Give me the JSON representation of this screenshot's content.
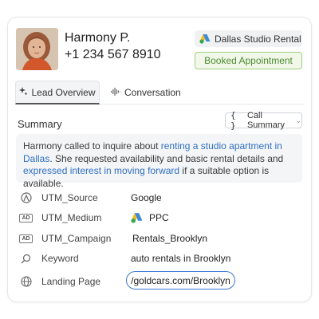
{
  "contact": {
    "name": "Harmony P.",
    "phone": "+1 234 567 8910"
  },
  "source": {
    "label": "Dallas Studio Rental",
    "icon": "google-ads-icon"
  },
  "status": {
    "label": "Booked Appointment",
    "color": "#9fcf7d"
  },
  "tabs": [
    {
      "label": "Lead Overview",
      "icon": "sparkle-icon",
      "active": true
    },
    {
      "label": "Conversation",
      "icon": "waveform-icon",
      "active": false
    }
  ],
  "summary": {
    "title": "Summary",
    "button_label": "Call Summary",
    "text_parts": [
      "Harmony called to inquire about ",
      "renting a studio apartment in Dallas",
      ". She requested availability and basic rental details and ",
      "expressed interest in moving forward",
      " if a suitable option is available."
    ]
  },
  "details": [
    {
      "label": "UTM_Source",
      "value": "Google",
      "icon": "source-icon"
    },
    {
      "label": "UTM_Medium",
      "value": "PPC",
      "icon": "ad-icon",
      "value_icon": "google-ads-icon"
    },
    {
      "label": "UTM_Campaign",
      "value": "Rentals_Brooklyn",
      "icon": "ad-icon"
    },
    {
      "label": "Keyword",
      "value": "auto rentals in Brooklyn",
      "icon": "search-icon"
    },
    {
      "label": "Landing Page",
      "value": "/goldcars.com/Brooklyn",
      "icon": "globe-icon"
    }
  ],
  "ad_badge_text": "AD",
  "colors": {
    "accent_blue": "#3b78d4",
    "link_blue": "#2f6fc2",
    "success_green": "#4e8a2e"
  }
}
